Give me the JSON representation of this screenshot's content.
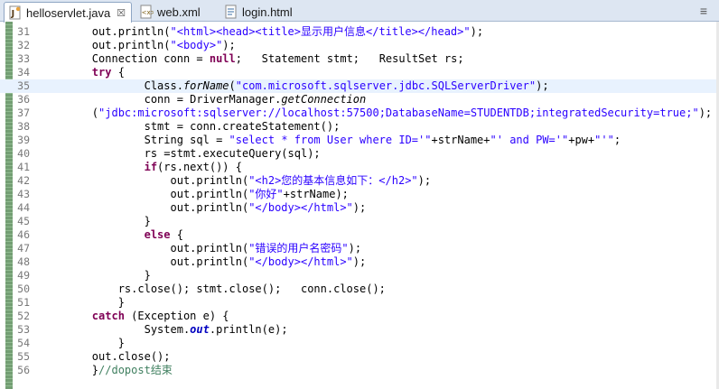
{
  "tabs": [
    {
      "label": "helloservlet.java",
      "icon": "java-file-icon",
      "active": true,
      "close": "☒"
    },
    {
      "label": "web.xml",
      "icon": "xml-file-icon",
      "active": false
    },
    {
      "label": "login.html",
      "icon": "html-file-icon",
      "active": false
    }
  ],
  "window_control_label": "≡",
  "editor": {
    "highlighted_line": "35",
    "lines": [
      {
        "num": "31",
        "code": "        out.println(\"<html><head><title>显示用户信息</title></head>\");"
      },
      {
        "num": "32",
        "code": "        out.println(\"<body>\");"
      },
      {
        "num": "33",
        "code": "        Connection conn = null;   Statement stmt;   ResultSet rs;"
      },
      {
        "num": "34",
        "code": "        try {"
      },
      {
        "num": "35",
        "code": "                Class.forName(\"com.microsoft.sqlserver.jdbc.SQLServerDriver\");"
      },
      {
        "num": "36",
        "code": "                conn = DriverManager.getConnection"
      },
      {
        "num": "37",
        "code": "        (\"jdbc:microsoft:sqlserver://localhost:57500;DatabaseName=STUDENTDB;integratedSecurity=true;\");"
      },
      {
        "num": "38",
        "code": "                stmt = conn.createStatement();"
      },
      {
        "num": "39",
        "code": "                String sql = \"select * from User where ID='\"+strName+\"' and PW='\"+pw+\"'\";"
      },
      {
        "num": "40",
        "code": "                rs =stmt.executeQuery(sql);"
      },
      {
        "num": "41",
        "code": "                if(rs.next()) {"
      },
      {
        "num": "42",
        "code": "                    out.println(\"<h2>您的基本信息如下：</h2>\");"
      },
      {
        "num": "43",
        "code": "                    out.println(\"你好\"+strName);"
      },
      {
        "num": "44",
        "code": "                    out.println(\"</body></html>\");"
      },
      {
        "num": "45",
        "code": "                }"
      },
      {
        "num": "46",
        "code": "                else {"
      },
      {
        "num": "47",
        "code": "                    out.println(\"错误的用户名密码\");"
      },
      {
        "num": "48",
        "code": "                    out.println(\"</body></html>\");"
      },
      {
        "num": "49",
        "code": "                }"
      },
      {
        "num": "50",
        "code": "            rs.close(); stmt.close();   conn.close();"
      },
      {
        "num": "51",
        "code": "            }"
      },
      {
        "num": "52",
        "code": "        catch (Exception e) {"
      },
      {
        "num": "53",
        "code": "                System.out.println(e);"
      },
      {
        "num": "54",
        "code": "            }"
      },
      {
        "num": "55",
        "code": "        out.close();"
      },
      {
        "num": "56",
        "code": "        }//dopost结束"
      }
    ]
  },
  "colors": {
    "keyword": "#7f0055",
    "string": "#2a00ff",
    "comment": "#3f7f5f",
    "field": "#0000c0",
    "current_line": "#e8f2fe"
  }
}
